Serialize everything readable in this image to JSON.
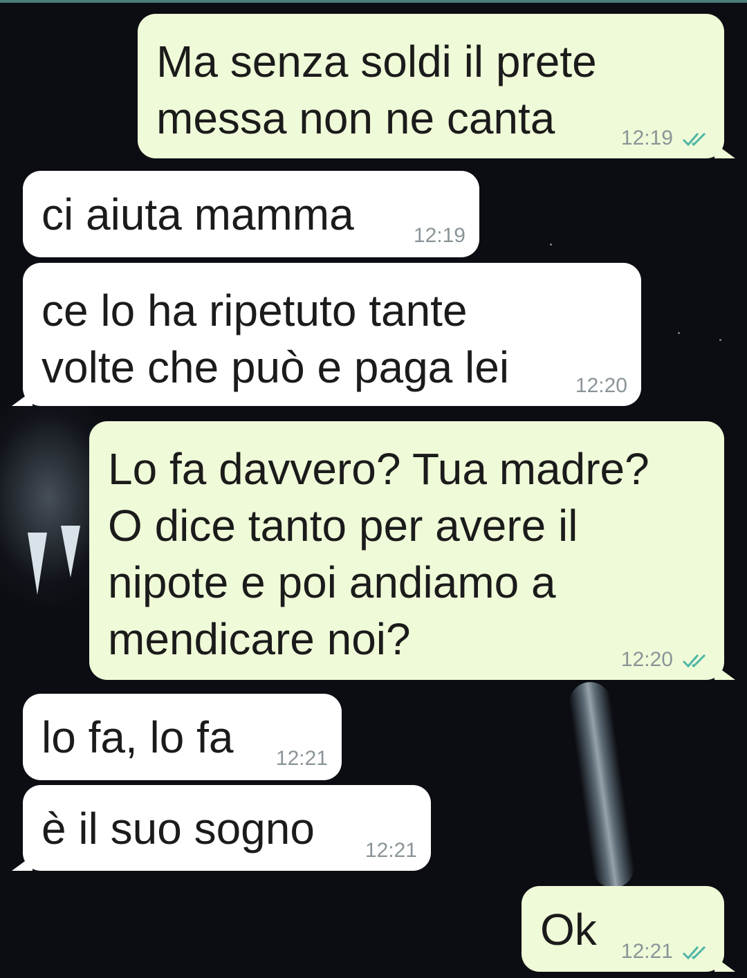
{
  "messages": [
    {
      "direction": "out",
      "text": "Ma senza soldi il prete\nmessa non ne canta",
      "time": "12:19",
      "read": true
    },
    {
      "direction": "in",
      "text": "ci aiuta mamma",
      "time": "12:19"
    },
    {
      "direction": "in",
      "text": "ce lo ha ripetuto tante\nvolte che può e paga lei",
      "time": "12:20"
    },
    {
      "direction": "out",
      "text": "Lo fa davvero? Tua madre?\nO dice tanto per avere il\nnipote e poi andiamo a\nmendicare noi?",
      "time": "12:20",
      "read": true
    },
    {
      "direction": "in",
      "text": "lo fa, lo fa",
      "time": "12:21"
    },
    {
      "direction": "in",
      "text": "è il suo sogno",
      "time": "12:21"
    },
    {
      "direction": "out",
      "text": "Ok",
      "time": "12:21",
      "read": true
    }
  ],
  "icons": {
    "read_receipt": "double-check-icon"
  },
  "colors": {
    "incoming_bubble": "#ffffff",
    "outgoing_bubble": "#effad8",
    "tick": "#4fb6a5",
    "background": "#0b0d12"
  }
}
